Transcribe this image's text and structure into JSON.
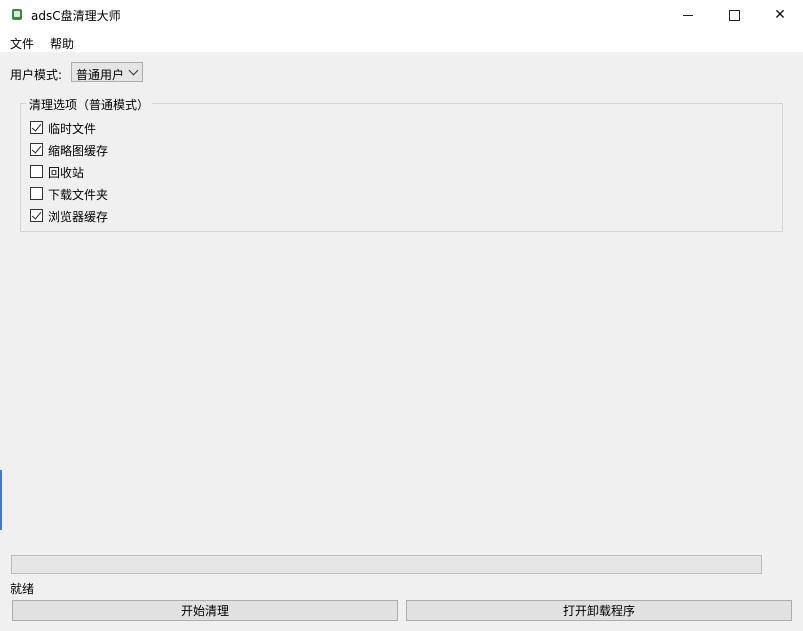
{
  "window": {
    "title": "adsC盘清理大师",
    "icon": "app-icon",
    "controls": [
      "minimize-icon",
      "maximize-icon",
      "close-icon"
    ]
  },
  "menu": {
    "items": [
      "文件",
      "帮助"
    ]
  },
  "mode": {
    "label": "用户模式:",
    "selected": "普通用户"
  },
  "options": {
    "group_title": "清理选项（普通模式）",
    "items": [
      {
        "label": "临时文件",
        "checked": true
      },
      {
        "label": "缩略图缓存",
        "checked": true
      },
      {
        "label": "回收站",
        "checked": false
      },
      {
        "label": "下载文件夹",
        "checked": false
      },
      {
        "label": "浏览器缓存",
        "checked": true
      }
    ]
  },
  "progress": {
    "value": 0
  },
  "status": "就绪",
  "buttons": {
    "start": "开始清理",
    "uninstall": "打开卸载程序"
  }
}
